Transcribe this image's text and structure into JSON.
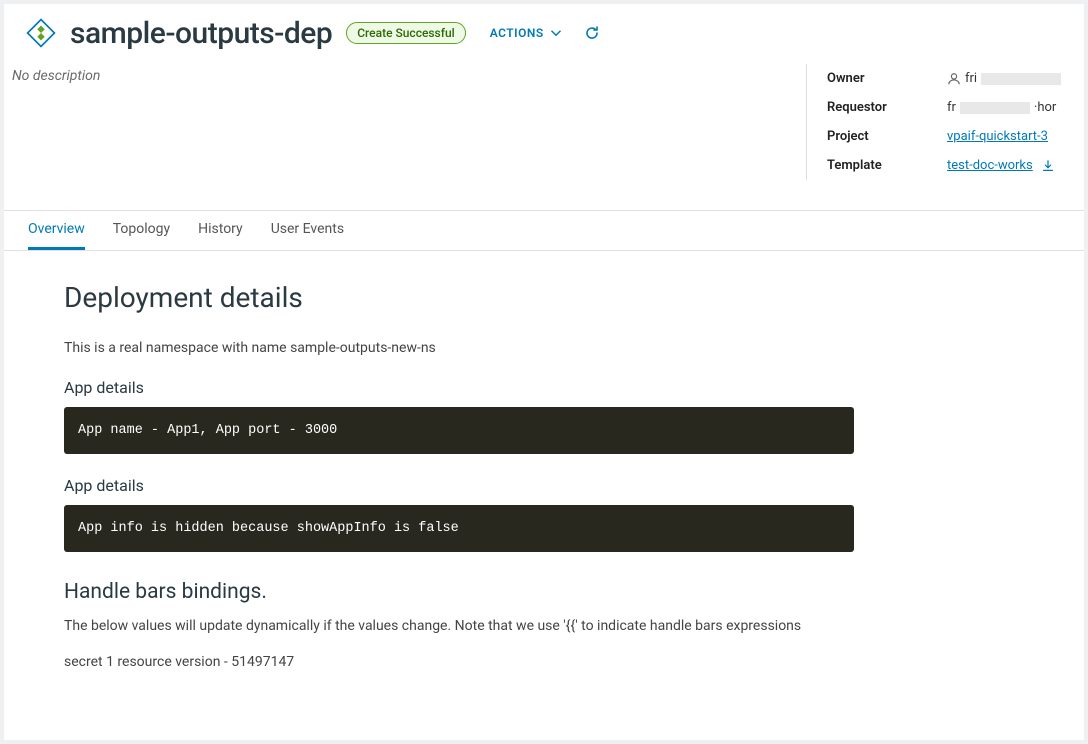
{
  "header": {
    "title": "sample-outputs-dep",
    "status_badge": "Create Successful",
    "actions_label": "ACTIONS"
  },
  "description": "No description",
  "meta": {
    "owner_label": "Owner",
    "owner_value_prefix": "fri",
    "requestor_label": "Requestor",
    "requestor_value_prefix": "fr",
    "requestor_value_suffix": "·hor",
    "project_label": "Project",
    "project_value": "vpaif-quickstart-3",
    "template_label": "Template",
    "template_value": "test-doc-works"
  },
  "tabs": {
    "overview": "Overview",
    "topology": "Topology",
    "history": "History",
    "user_events": "User Events"
  },
  "details": {
    "heading": "Deployment details",
    "namespace_text": "This is a real namespace with name sample-outputs-new-ns",
    "app_details_label1": "App details",
    "code1": "App name - App1, App port - 3000",
    "app_details_label2": "App details",
    "code2": "App info is hidden because showAppInfo is false",
    "bindings_heading": "Handle bars bindings.",
    "bindings_text": "The below values will update dynamically if the values change. Note that we use '{{' to indicate handle bars expressions",
    "secret_line": "secret 1 resource version - 51497147"
  }
}
